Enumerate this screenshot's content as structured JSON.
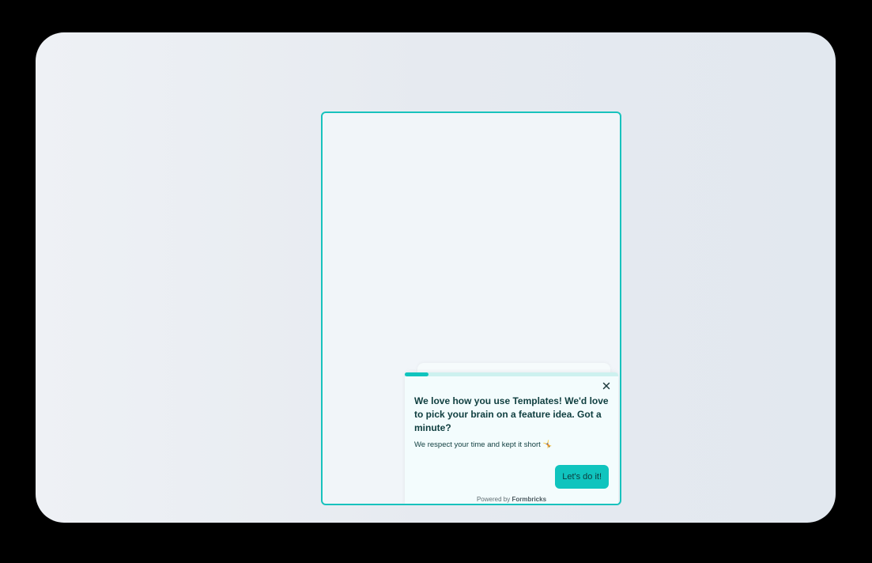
{
  "survey": {
    "progress_fraction": 0.11,
    "headline": "We love how you use Templates! We'd love to pick your brain on a feature idea. Got a minute?",
    "subheader": "We respect your time and kept it short 🤸",
    "cta_label": "Let's do it!",
    "powered_by_prefix": "Powered by",
    "powered_by_brand": "Formbricks"
  },
  "icons": {
    "close": "close-icon"
  },
  "colors": {
    "accent": "#10c4be",
    "device_border": "#18c2bd",
    "headline_text": "#0f3e3f"
  }
}
